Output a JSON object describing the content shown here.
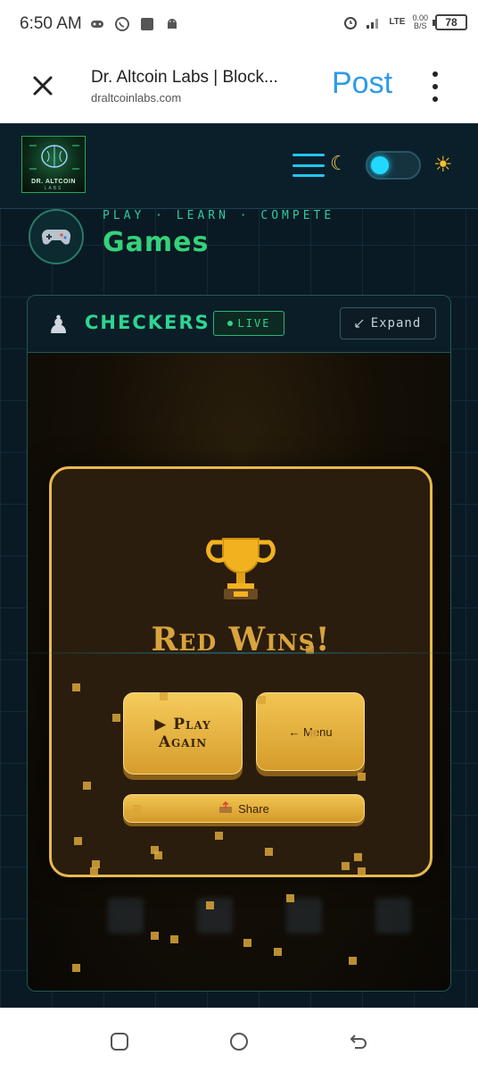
{
  "status_bar": {
    "time": "6:50 AM",
    "network": "LTE",
    "speed_value": "0.00",
    "speed_unit": "B/S",
    "battery": "78"
  },
  "browser": {
    "title": "Dr. Altcoin Labs | Block...",
    "url": "draltcoinlabs.com",
    "post_label": "Post"
  },
  "site": {
    "logo_text": "DR. ALTCOIN",
    "logo_sub": "LABS",
    "tagline": "PLAY · LEARN · COMPETE",
    "section_title": "Games"
  },
  "game_card": {
    "title": "CHECKERS",
    "live_label": "LIVE",
    "expand_label": "Expand"
  },
  "win_modal": {
    "title": "Red Wins!",
    "play_again_line1": "▶ Play",
    "play_again_line2": "Again",
    "menu_label": "← Menu",
    "share_label": "Share"
  },
  "colors": {
    "accent_green": "#2fd490",
    "accent_cyan": "#22c6ef",
    "gold": "#e7b94e",
    "page_bg": "#0a1a24"
  },
  "icons": [
    "close-icon",
    "more-vert-icon",
    "hamburger-icon",
    "moon-icon",
    "sun-icon",
    "gamepad-icon",
    "pawn-icon",
    "expand-icon",
    "trophy-icon",
    "share-icon",
    "recents-icon",
    "home-icon",
    "back-icon"
  ]
}
